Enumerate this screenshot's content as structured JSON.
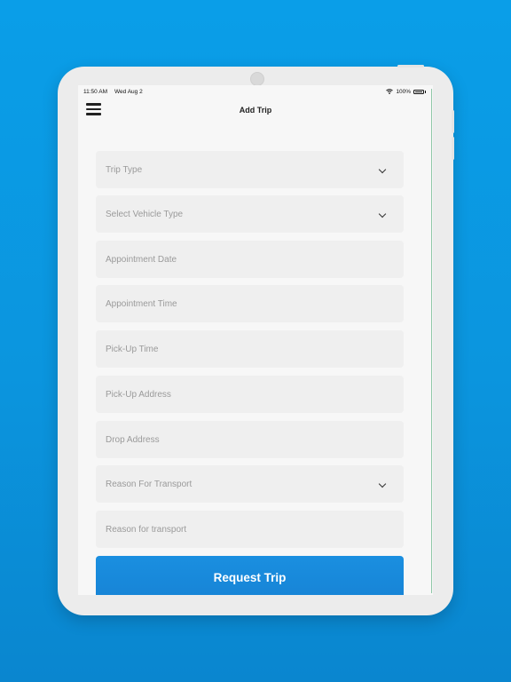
{
  "status_bar": {
    "time": "11:50 AM",
    "date": "Wed Aug 2",
    "battery": "100%",
    "icons": [
      "wifi-icon",
      "battery-icon"
    ]
  },
  "nav": {
    "title": "Add Trip",
    "menu_icon": "hamburger-menu-icon"
  },
  "form": {
    "trip_type": "Trip Type",
    "vehicle_type": "Select Vehicle Type",
    "appointment_date": "Appointment Date",
    "appointment_time": "Appointment Time",
    "pickup_time": "Pick-Up Time",
    "pickup_address": "Pick-Up Address",
    "drop_address": "Drop Address",
    "reason_select": "Reason For Transport",
    "reason_text": "Reason for transport",
    "submit_label": "Request Trip"
  },
  "colors": {
    "background": "#0b95de",
    "accent": "#1784d6",
    "field_bg": "#efefef",
    "placeholder": "#9a9a9a"
  }
}
